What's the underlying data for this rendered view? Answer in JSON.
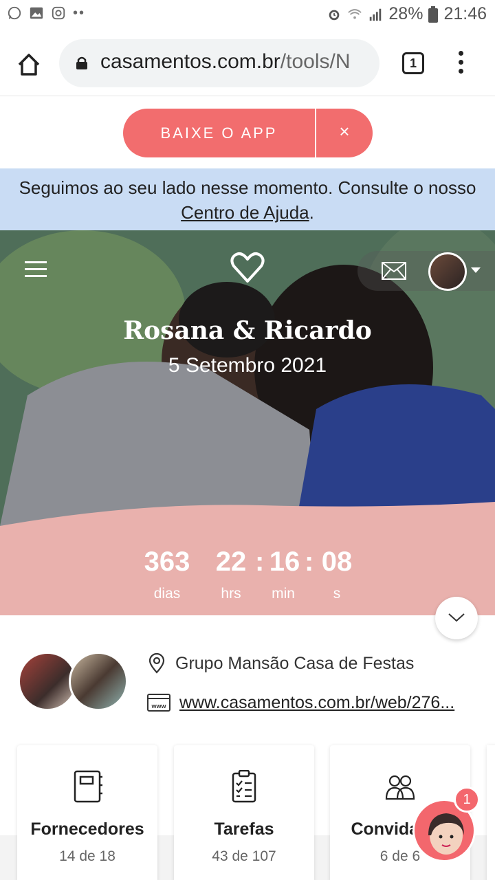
{
  "status_bar": {
    "battery": "28%",
    "time": "21:46"
  },
  "browser": {
    "url_domain": "casamentos.com.br",
    "url_path": "/tools/N",
    "tab_count": "1"
  },
  "app_banner": {
    "label": "BAIXE O APP",
    "close": "×"
  },
  "info_banner": {
    "text_before": "Seguimos ao seu lado nesse momento. Consulte o nosso ",
    "link": "Centro de Ajuda",
    "text_after": "."
  },
  "hero": {
    "names": "Rosana & Ricardo",
    "date": "5 Setembro 2021"
  },
  "countdown": {
    "days": "363",
    "days_label": "dias",
    "hours": "22",
    "hours_label": "hrs",
    "minutes": "16",
    "minutes_label": "min",
    "seconds": "08",
    "seconds_label": "s",
    "separator": ":"
  },
  "details": {
    "venue": "Grupo Mansão Casa de Festas",
    "website": "www.casamentos.com.br/web/276..."
  },
  "cards": [
    {
      "title": "Fornecedores",
      "subtitle": "14 de 18"
    },
    {
      "title": "Tarefas",
      "subtitle": "43 de 107"
    },
    {
      "title": "Convidados",
      "subtitle": "6 de 6"
    }
  ],
  "assistant": {
    "badge": "1"
  },
  "colors": {
    "coral": "#f26d6e",
    "pink": "#e9b1ad",
    "info_bg": "#c9dcf4"
  }
}
